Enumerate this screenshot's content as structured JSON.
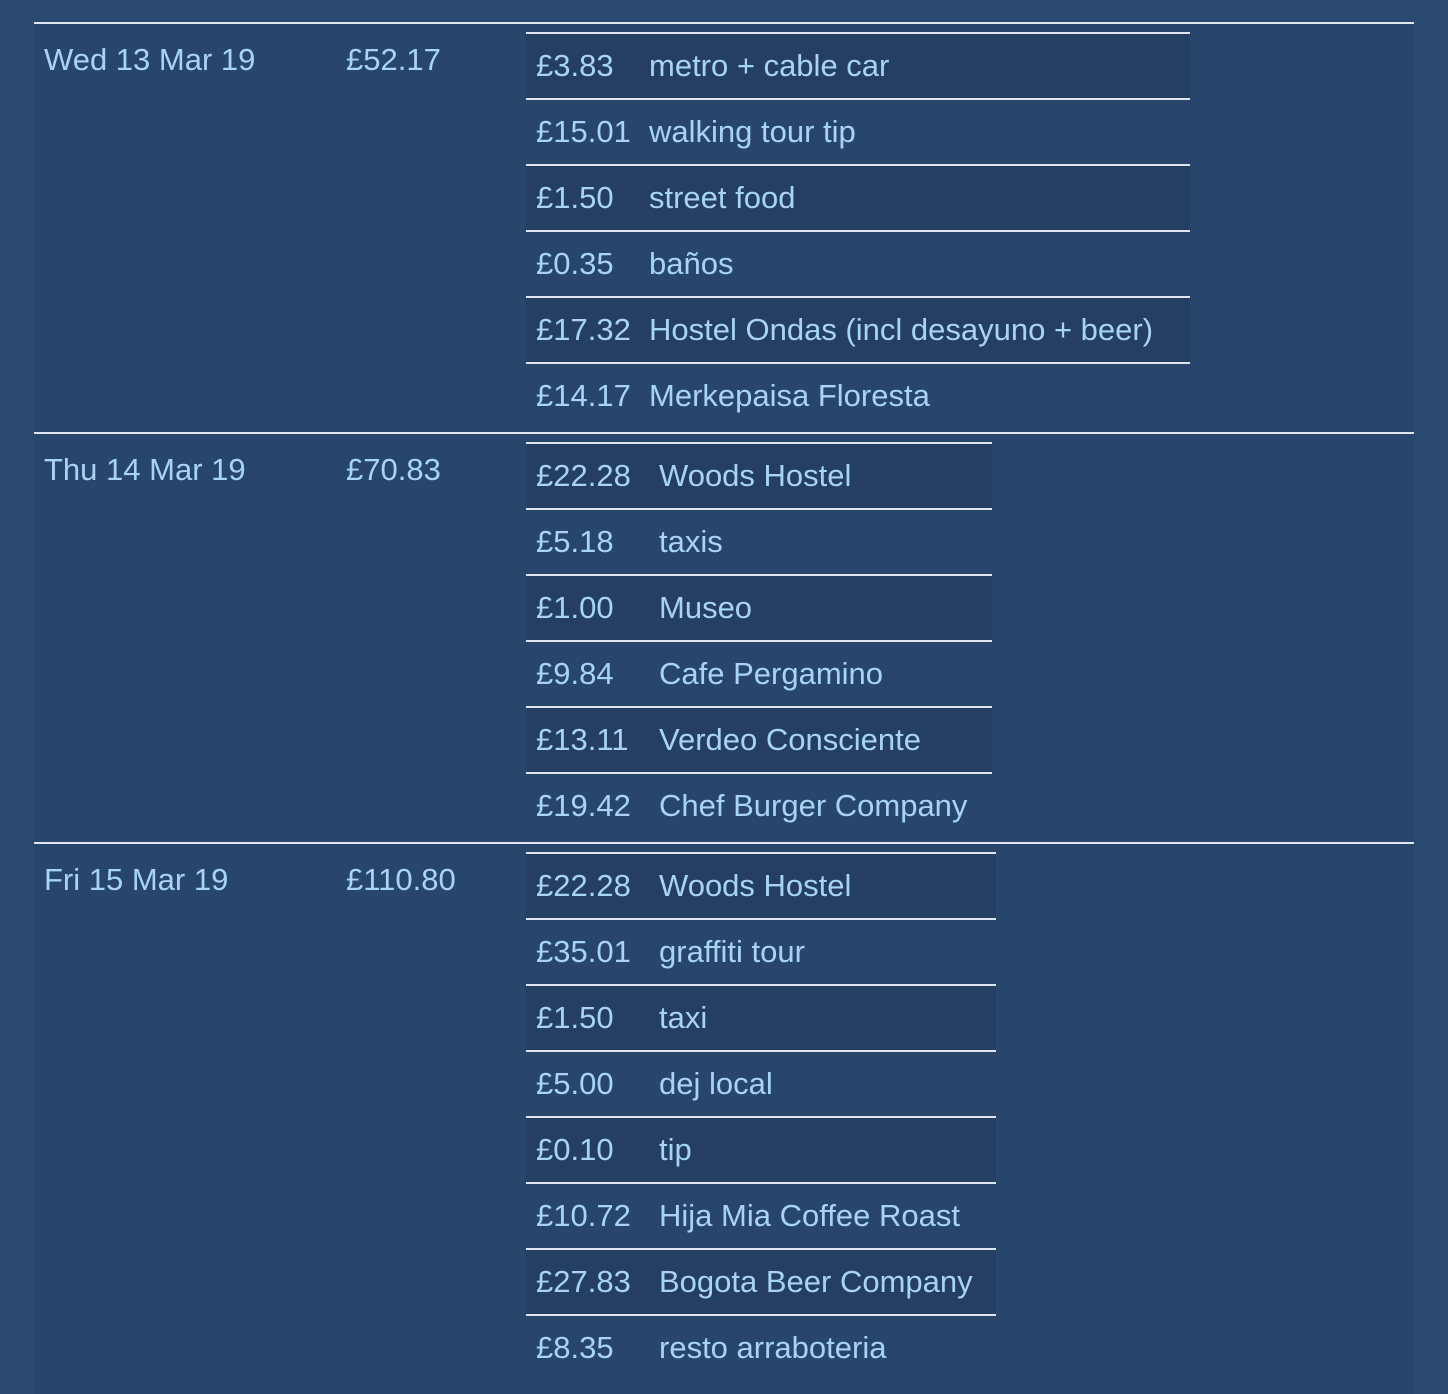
{
  "days": [
    {
      "date": "Wed 13 Mar 19",
      "total": "£52.17",
      "items": [
        {
          "amount": "£3.83",
          "desc": "metro + cable car"
        },
        {
          "amount": "£15.01",
          "desc": "walking tour tip"
        },
        {
          "amount": "£1.50",
          "desc": "street food"
        },
        {
          "amount": "£0.35",
          "desc": "baños"
        },
        {
          "amount": "£17.32",
          "desc": "Hostel Ondas (incl desayuno + beer)"
        },
        {
          "amount": "£14.17",
          "desc": "Merkepaisa Floresta"
        }
      ]
    },
    {
      "date": "Thu 14 Mar 19",
      "total": "£70.83",
      "items": [
        {
          "amount": "£22.28",
          "desc": "Woods Hostel"
        },
        {
          "amount": "£5.18",
          "desc": "taxis"
        },
        {
          "amount": "£1.00",
          "desc": "Museo"
        },
        {
          "amount": "£9.84",
          "desc": "Cafe Pergamino"
        },
        {
          "amount": "£13.11",
          "desc": "Verdeo Consciente"
        },
        {
          "amount": "£19.42",
          "desc": "Chef Burger Company"
        }
      ]
    },
    {
      "date": "Fri 15 Mar 19",
      "total": "£110.80",
      "items": [
        {
          "amount": "£22.28",
          "desc": "Woods Hostel"
        },
        {
          "amount": "£35.01",
          "desc": "graffiti tour"
        },
        {
          "amount": "£1.50",
          "desc": "taxi"
        },
        {
          "amount": "£5.00",
          "desc": "dej local"
        },
        {
          "amount": "£0.10",
          "desc": "tip"
        },
        {
          "amount": "£10.72",
          "desc": "Hija Mia Coffee Roast"
        },
        {
          "amount": "£27.83",
          "desc": "Bogota Beer Company"
        },
        {
          "amount": "£8.35",
          "desc": "resto arraboteria"
        }
      ]
    }
  ]
}
